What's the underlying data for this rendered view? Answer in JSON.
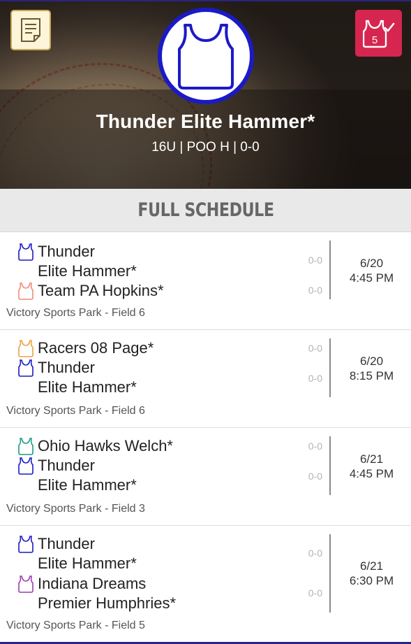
{
  "header": {
    "team_name": "Thunder Elite Hammer*",
    "team_meta": "16U | POO H | 0-0",
    "notes_icon": "document-icon",
    "checkin_icon": "jersey-check-icon",
    "checkin_count": "5",
    "logo_icon": "jersey-icon",
    "logo_color": "#1b1ac6"
  },
  "section": {
    "title": "FULL SCHEDULE"
  },
  "games": [
    {
      "teams": [
        {
          "lines": [
            "Thunder",
            "Elite Hammer*"
          ],
          "color": "#1b1ac6",
          "score": "0-0"
        },
        {
          "lines": [
            "Team PA Hopkins*"
          ],
          "color": "#f08a7a",
          "score": "0-0"
        }
      ],
      "date": "6/20",
      "time": "4:45 PM",
      "venue": "Victory Sports Park - Field 6"
    },
    {
      "teams": [
        {
          "lines": [
            "Racers 08 Page*"
          ],
          "color": "#f0a040",
          "score": "0-0"
        },
        {
          "lines": [
            "Thunder",
            "Elite Hammer*"
          ],
          "color": "#1b1ac6",
          "score": "0-0"
        }
      ],
      "date": "6/20",
      "time": "8:15 PM",
      "venue": "Victory Sports Park - Field 6"
    },
    {
      "teams": [
        {
          "lines": [
            "Ohio Hawks Welch*"
          ],
          "color": "#1a9a8a",
          "score": "0-0"
        },
        {
          "lines": [
            "Thunder",
            "Elite Hammer*"
          ],
          "color": "#1b1ac6",
          "score": "0-0"
        }
      ],
      "date": "6/21",
      "time": "4:45 PM",
      "venue": "Victory Sports Park - Field 3"
    },
    {
      "teams": [
        {
          "lines": [
            "Thunder",
            "Elite Hammer*"
          ],
          "color": "#1b1ac6",
          "score": "0-0"
        },
        {
          "lines": [
            "Indiana Dreams",
            "Premier Humphries*"
          ],
          "color": "#9a3fb0",
          "score": "0-0"
        }
      ],
      "date": "6/21",
      "time": "6:30 PM",
      "venue": "Victory Sports Park - Field 5"
    }
  ]
}
